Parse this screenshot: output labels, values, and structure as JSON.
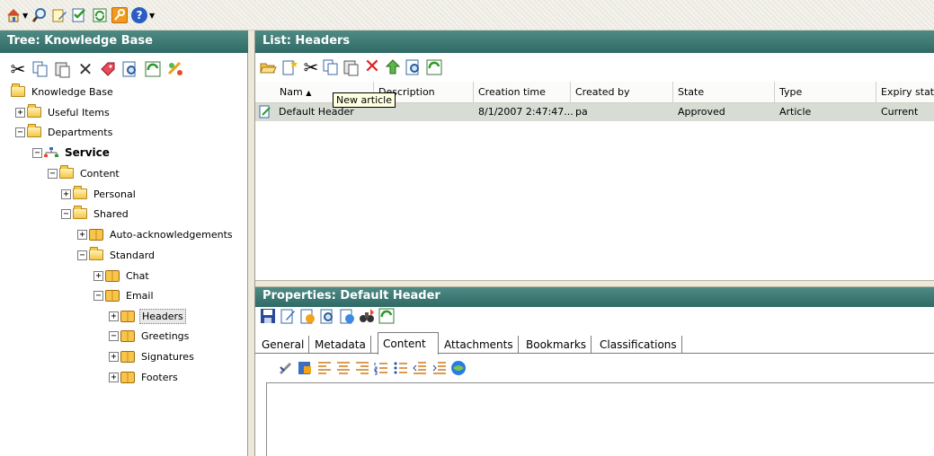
{
  "top_toolbar": {
    "icons": [
      "home-icon",
      "search-icon",
      "note-edit-icon",
      "checklist-icon",
      "refresh-icon",
      "key-icon",
      "help-icon"
    ]
  },
  "tree_pane": {
    "title": "Tree: Knowledge Base",
    "toolbar_icons": [
      "cut-icon",
      "copy-icon",
      "paste-icon",
      "delete-icon",
      "tag-icon",
      "find-icon",
      "refresh-icon",
      "link-icon"
    ],
    "nodes": [
      {
        "label": "Knowledge Base",
        "toggle": "",
        "icon": "folder"
      },
      {
        "label": "Useful Items",
        "toggle": "+",
        "icon": "folder"
      },
      {
        "label": "Departments",
        "toggle": "−",
        "icon": "folder"
      },
      {
        "label": "Service",
        "toggle": "−",
        "icon": "service"
      },
      {
        "label": "Content",
        "toggle": "−",
        "icon": "folder"
      },
      {
        "label": "Personal",
        "toggle": "+",
        "icon": "folder"
      },
      {
        "label": "Shared",
        "toggle": "−",
        "icon": "folder"
      },
      {
        "label": "Auto-acknowledgements",
        "toggle": "+",
        "icon": "book"
      },
      {
        "label": "Standard",
        "toggle": "−",
        "icon": "folder"
      },
      {
        "label": "Chat",
        "toggle": "+",
        "icon": "book"
      },
      {
        "label": "Email",
        "toggle": "−",
        "icon": "book"
      },
      {
        "label": "Headers",
        "toggle": "+",
        "icon": "book"
      },
      {
        "label": "Greetings",
        "toggle": "−",
        "icon": "book"
      },
      {
        "label": "Signatures",
        "toggle": "+",
        "icon": "book"
      },
      {
        "label": "Footers",
        "toggle": "+",
        "icon": "book"
      }
    ]
  },
  "list_pane": {
    "title": "List: Headers",
    "toolbar_icons": [
      "open-folder-icon",
      "new-article-icon",
      "cut-icon",
      "copy-icon",
      "paste-icon",
      "delete-icon",
      "move-up-icon",
      "find-icon",
      "refresh-icon"
    ],
    "tooltip": "New article",
    "columns": [
      "Name",
      "Description",
      "Creation time",
      "Created by",
      "State",
      "Type",
      "Expiry state"
    ],
    "name_col_partial": "Nam",
    "name_col_sort": "▲",
    "rows": [
      {
        "name": "Default Header",
        "description": "",
        "creation_time": "8/1/2007 2:47:47...",
        "created_by": "pa",
        "state": "Approved",
        "type": "Article",
        "expiry_state": "Current"
      }
    ]
  },
  "properties_pane": {
    "title": "Properties: Default Header",
    "toolbar_icons": [
      "save-icon",
      "edit-icon",
      "approve-icon",
      "preview-icon",
      "publish-icon",
      "binoculars-icon",
      "refresh-icon"
    ],
    "tabs": [
      "General",
      "Metadata",
      "Content",
      "Attachments",
      "Bookmarks",
      "Classifications"
    ],
    "active_tab": "Content",
    "editor_icons": [
      "spellcheck-icon",
      "insert-icon",
      "align-left-icon",
      "align-center-icon",
      "align-right-icon",
      "numbered-list-icon",
      "bullet-list-icon",
      "outdent-icon",
      "indent-icon",
      "web-icon"
    ]
  },
  "colors": {
    "title_bar": "#3d7a75",
    "selected_row": "#d7dcd4",
    "tooltip_bg": "#ffffe1"
  }
}
